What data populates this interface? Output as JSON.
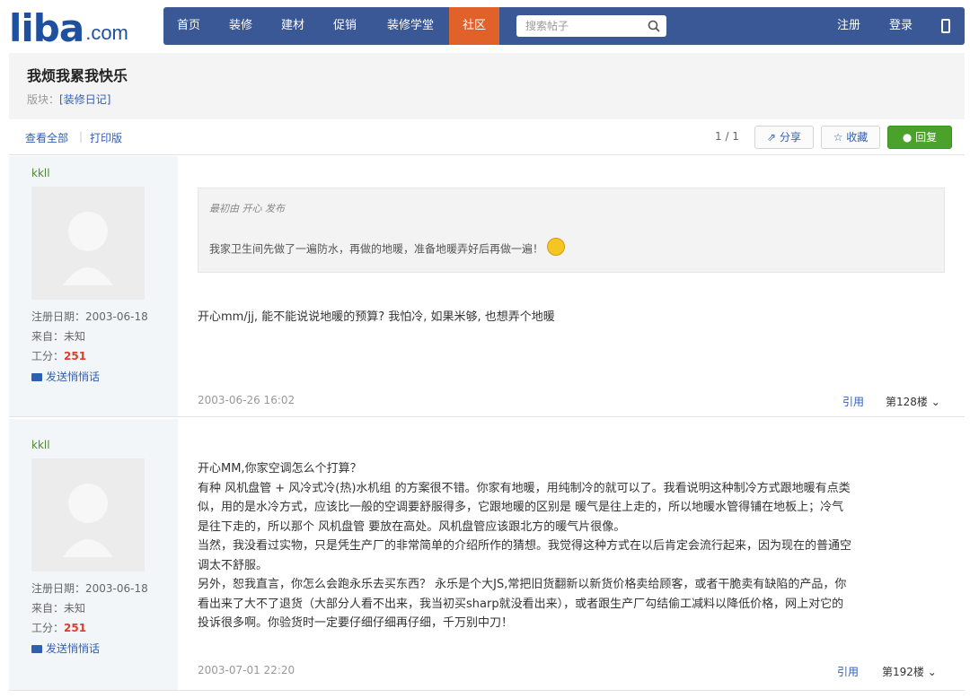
{
  "header": {
    "logo_text": "liba",
    "logo_domain": ".com",
    "nav": [
      "首页",
      "装修",
      "建材",
      "促销",
      "装修学堂",
      "社区"
    ],
    "active_nav": "社区",
    "search_placeholder": "搜索帖子",
    "register": "注册",
    "login": "登录",
    "accent_color": "#e0622a",
    "nav_color": "#3a5796"
  },
  "thread": {
    "title": "我烦我累我快乐",
    "section_label": "版块：",
    "section_name": "[装修日记]"
  },
  "toolbar": {
    "view_all": "查看全部",
    "print": "打印版",
    "pager": "1 / 1",
    "share": "分享",
    "favorite": "收藏",
    "reply": "回复"
  },
  "posts": [
    {
      "username": "kkll",
      "reg_label": "注册日期：",
      "reg_date": "2003-06-18",
      "from_label": "来自：",
      "from": "未知",
      "points_label": "工分：",
      "points": "251",
      "message_link": "发送悄悄话",
      "quote_by": "最初由 开心 发布",
      "quote_text": "我家卫生间先做了一遍防水，再做的地暖，准备地暖弄好后再做一遍！",
      "body": [
        "开心mm/jj, 能不能说说地暖的预算? 我怕冷, 如果米够, 也想弄个地暖"
      ],
      "date": "2003-06-26 16:02",
      "cite": "引用",
      "floor": "第128楼"
    },
    {
      "username": "kkll",
      "reg_label": "注册日期：",
      "reg_date": "2003-06-18",
      "from_label": "来自：",
      "from": "未知",
      "points_label": "工分：",
      "points": "251",
      "message_link": "发送悄悄话",
      "body": [
        "开心MM,你家空调怎么个打算？",
        "有种 风机盘管 + 风冷式冷(热)水机组 的方案很不错。你家有地暖，用纯制冷的就可以了。我看说明这种制冷方式跟地暖有点类",
        "似，用的是水冷方式，应该比一般的空调要舒服得多，它跟地暖的区别是 暖气是往上走的，所以地暖水管得铺在地板上；冷气",
        "是往下走的，所以那个 风机盘管 要放在高处。风机盘管应该跟北方的暖气片很像。",
        "当然，我没看过实物，只是凭生产厂的非常简单的介绍所作的猜想。我觉得这种方式在以后肯定会流行起来，因为现在的普通空",
        "调太不舒服。",
        "另外，恕我直言，你怎么会跑永乐去买东西？ 永乐是个大JS,常把旧货翻新以新货价格卖给顾客，或者干脆卖有缺陷的产品，你",
        "看出来了大不了退货（大部分人看不出来，我当初买sharp就没看出来），或者跟生产厂勾结偷工减料以降低价格，网上对它的",
        "投诉很多啊。你验货时一定要仔细仔细再仔细，千万别中刀！"
      ],
      "date": "2003-07-01 22:20",
      "cite": "引用",
      "floor": "第192楼"
    }
  ]
}
